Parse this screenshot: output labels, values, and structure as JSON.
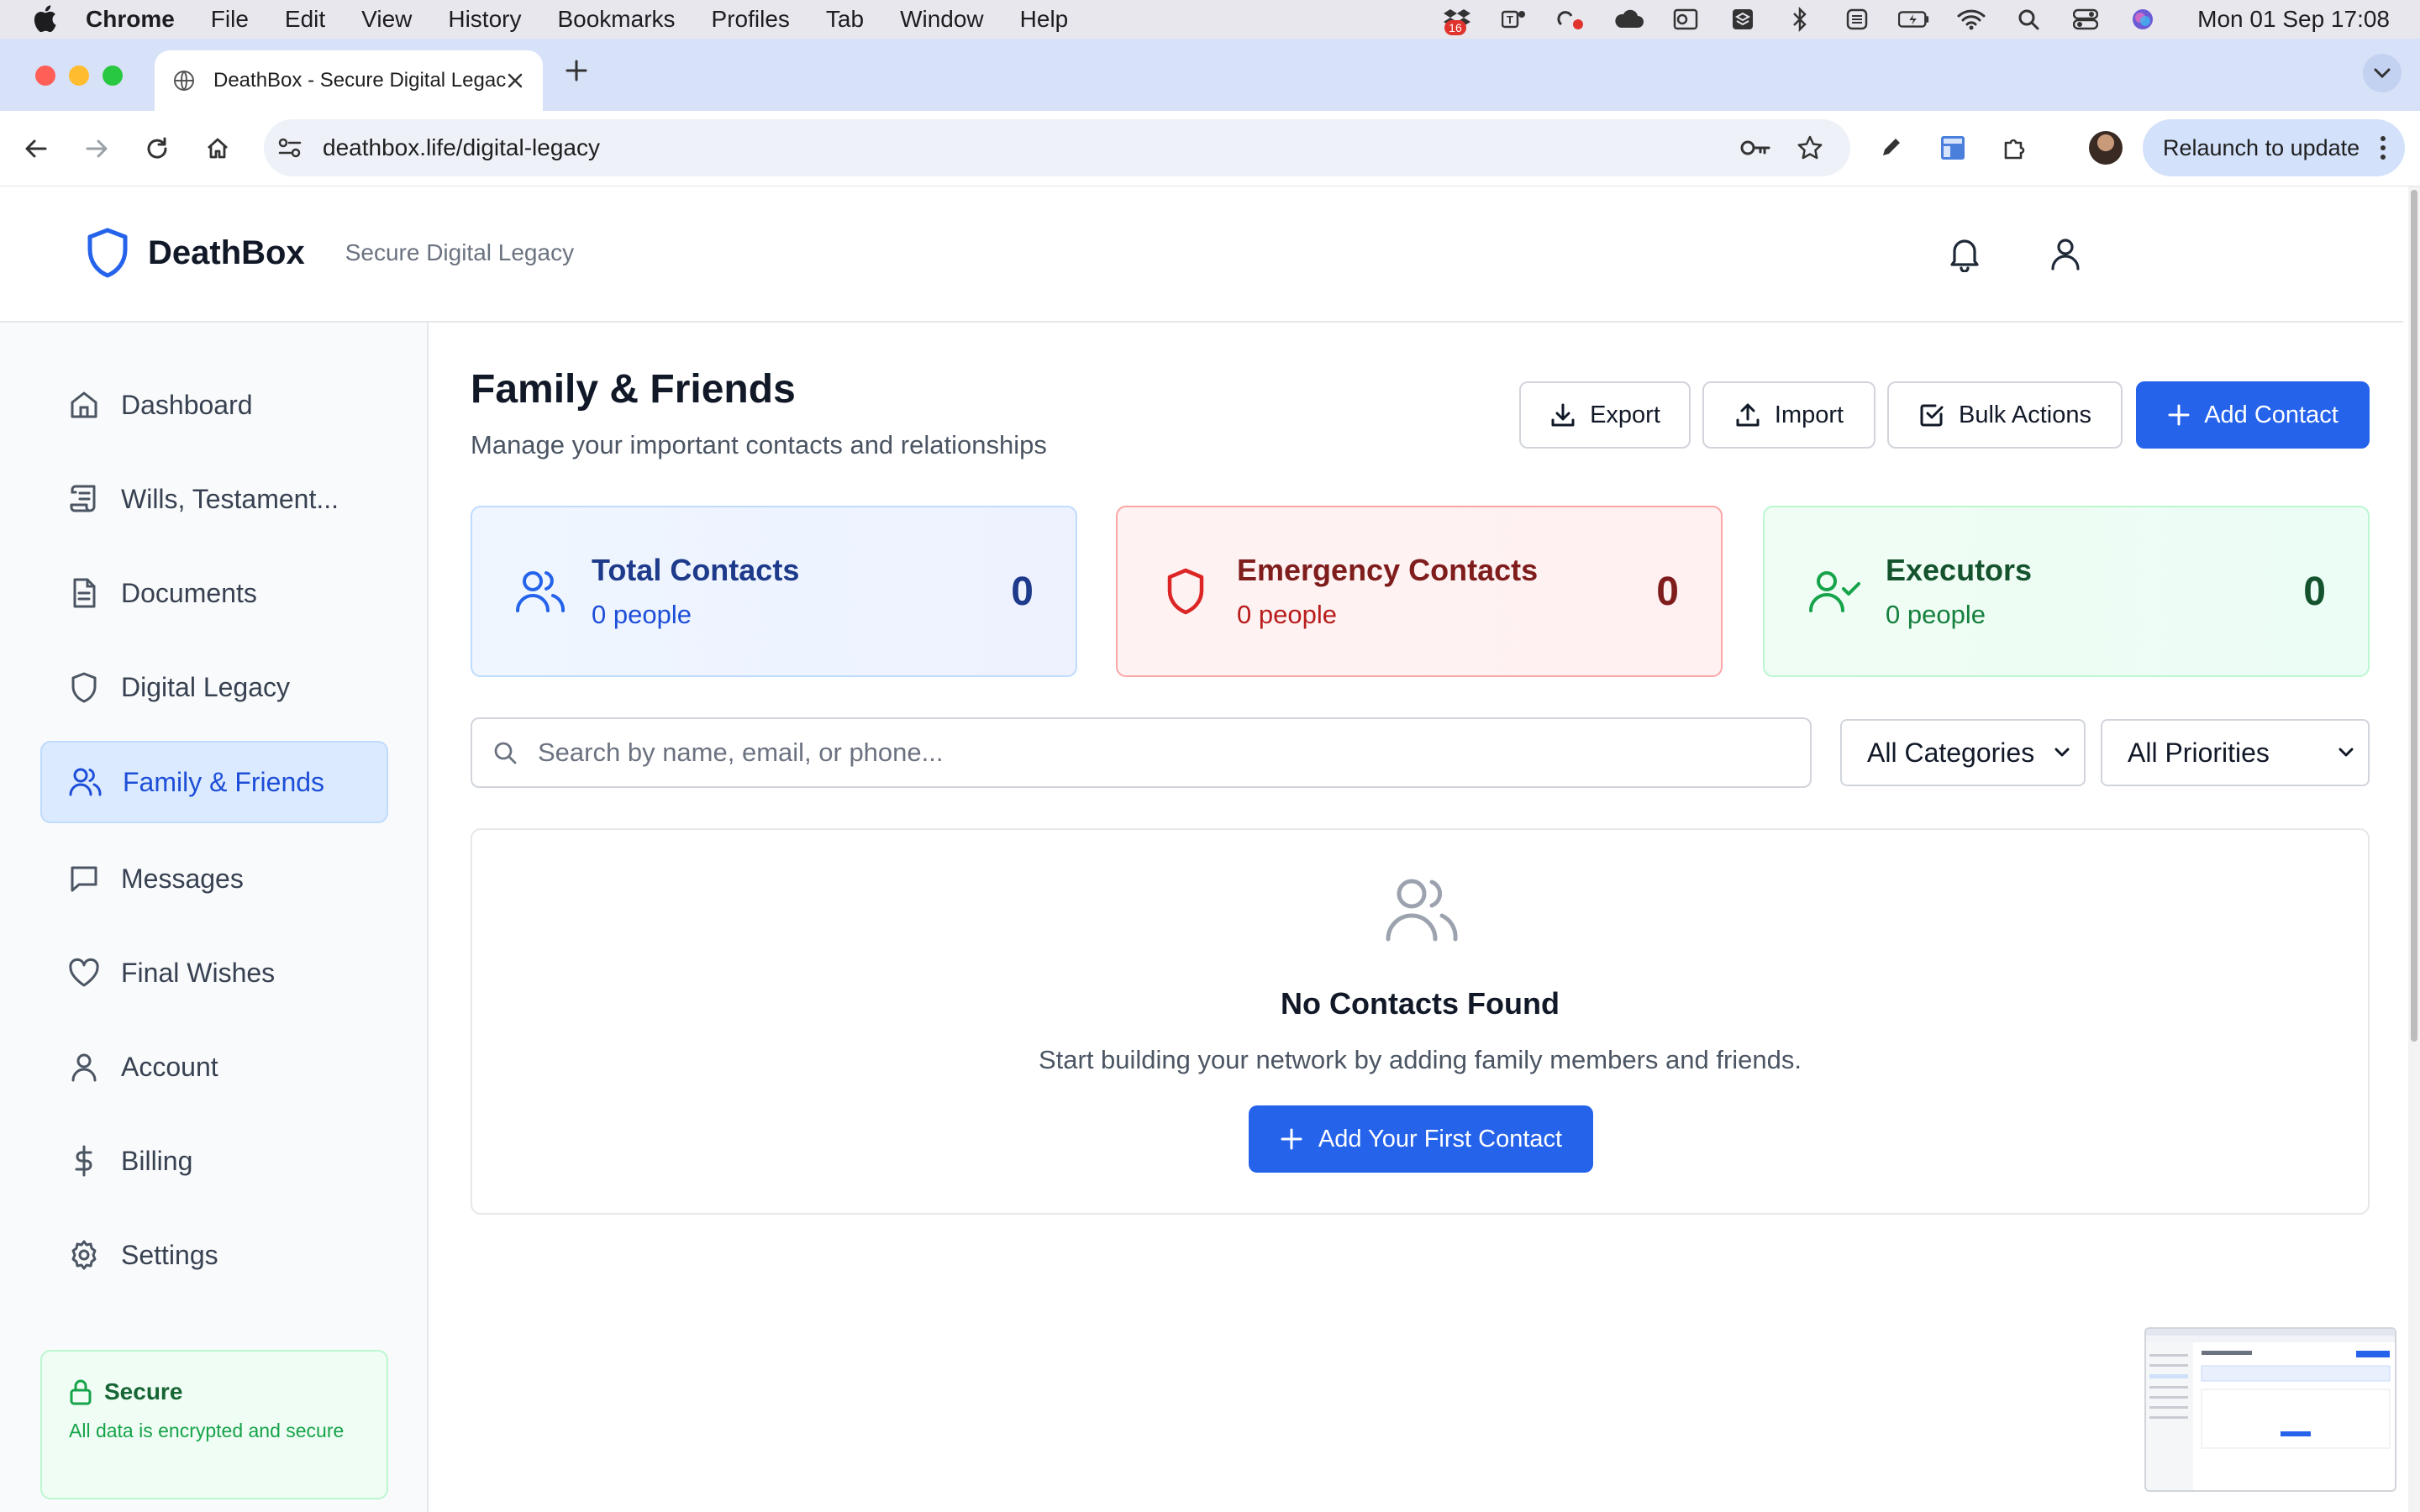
{
  "menubar": {
    "app_name": "Chrome",
    "items": [
      "File",
      "Edit",
      "View",
      "History",
      "Bookmarks",
      "Profiles",
      "Tab",
      "Window",
      "Help"
    ],
    "calendar_badge": "16",
    "clock": "Mon 01 Sep  17:08"
  },
  "browser": {
    "tab_title": "DeathBox - Secure Digital Legacy",
    "url": "deathbox.life/digital-legacy",
    "relaunch_label": "Relaunch to update"
  },
  "app": {
    "name": "DeathBox",
    "tagline": "Secure Digital Legacy"
  },
  "sidebar": {
    "items": [
      {
        "label": "Dashboard",
        "icon": "home-icon"
      },
      {
        "label": "Wills, Testament...",
        "icon": "scroll-icon"
      },
      {
        "label": "Documents",
        "icon": "file-text-icon"
      },
      {
        "label": "Digital Legacy",
        "icon": "shield-icon"
      },
      {
        "label": "Family & Friends",
        "icon": "users-icon",
        "active": true
      },
      {
        "label": "Messages",
        "icon": "message-square-icon"
      },
      {
        "label": "Final Wishes",
        "icon": "heart-icon"
      },
      {
        "label": "Account",
        "icon": "user-icon"
      },
      {
        "label": "Billing",
        "icon": "dollar-icon"
      },
      {
        "label": "Settings",
        "icon": "gear-icon"
      }
    ],
    "secure": {
      "title": "Secure",
      "description": "All data is encrypted and secure"
    }
  },
  "page": {
    "title": "Family & Friends",
    "subtitle": "Manage your important contacts and relationships",
    "actions": {
      "export": "Export",
      "import": "Import",
      "bulk": "Bulk Actions",
      "add": "Add Contact"
    }
  },
  "stats": [
    {
      "label": "Total Contacts",
      "sub": "0 people",
      "value": "0",
      "color": "#1e3a8a",
      "accent": "#2563eb"
    },
    {
      "label": "Emergency Contacts",
      "sub": "0 people",
      "value": "0",
      "color": "#7f1d1d",
      "accent": "#dc2626"
    },
    {
      "label": "Executors",
      "sub": "0 people",
      "value": "0",
      "color": "#14532d",
      "accent": "#16a34a"
    }
  ],
  "filters": {
    "search_placeholder": "Search by name, email, or phone...",
    "category": "All Categories",
    "priority": "All Priorities"
  },
  "empty_state": {
    "title": "No Contacts Found",
    "message": "Start building your network by adding family members and friends.",
    "cta": "Add Your First Contact"
  },
  "colors": {
    "primary": "#2563eb",
    "active_nav_bg": "#dbeafe",
    "secure_green": "#16a34a"
  }
}
